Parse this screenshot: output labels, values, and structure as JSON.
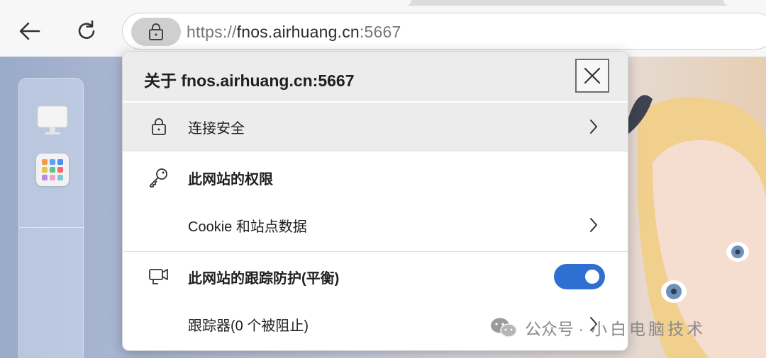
{
  "browser": {
    "url_scheme": "https://",
    "url_host": "fnos.airhuang.cn",
    "url_port": ":5667",
    "back_icon": "arrow-left-icon",
    "reload_icon": "refresh-icon",
    "lock_icon": "lock-icon"
  },
  "dock": {
    "items": [
      {
        "name": "monitor-icon"
      },
      {
        "name": "app-grid-icon"
      }
    ]
  },
  "popup": {
    "title": "关于 fnos.airhuang.cn:5667",
    "close_icon": "close-icon",
    "connection": {
      "label": "连接安全",
      "icon": "lock-icon"
    },
    "permissions": {
      "label": "此网站的权限",
      "icon": "key-icon"
    },
    "cookies": {
      "label": "Cookie 和站点数据"
    },
    "tracking": {
      "label": "此网站的跟踪防护(平衡)",
      "icon": "tracking-prevention-icon",
      "enabled": true
    },
    "trackers": {
      "label": "跟踪器(0 个被阻止)"
    }
  },
  "watermark": {
    "prefix": "公众号 ·",
    "author": "小白电脑技术"
  },
  "colors": {
    "accent": "#2e6fd1",
    "header_bg": "#ececec"
  }
}
